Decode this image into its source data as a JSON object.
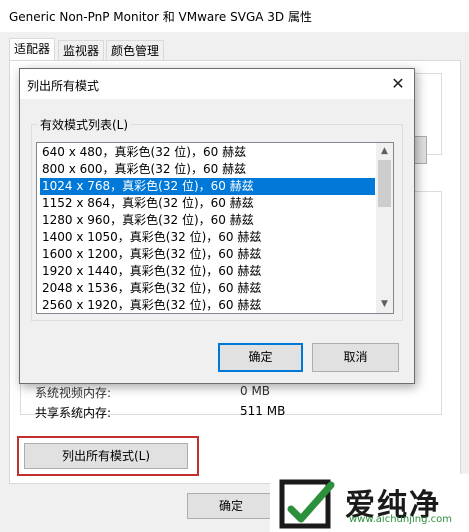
{
  "window": {
    "title": "Generic Non-PnP Monitor 和 VMware SVGA 3D 属性",
    "tabs": [
      "适配器",
      "监视器",
      "颜色管理"
    ],
    "info": [
      {
        "label": "系统视频内存:",
        "value": "0 MB"
      },
      {
        "label": "共享系统内存:",
        "value": "511 MB"
      }
    ],
    "list_all_button": "列出所有模式(L)",
    "ok_button": "确定"
  },
  "dialog": {
    "title": "列出所有模式",
    "close_glyph": "✕",
    "group_label": "有效模式列表(L)",
    "modes": [
      "640 x 480，真彩色(32 位)，60 赫兹",
      "800 x 600，真彩色(32 位)，60 赫兹",
      "1024 x 768，真彩色(32 位)，60 赫兹",
      "1152 x 864，真彩色(32 位)，60 赫兹",
      "1280 x 960，真彩色(32 位)，60 赫兹",
      "1400 x 1050，真彩色(32 位)，60 赫兹",
      "1600 x 1200，真彩色(32 位)，60 赫兹",
      "1920 x 1440，真彩色(32 位)，60 赫兹",
      "2048 x 1536，真彩色(32 位)，60 赫兹",
      "2560 x 1920，真彩色(32 位)，60 赫兹"
    ],
    "selected_mode": "1024 x 768，真彩色(32 位)，60 赫兹",
    "ok_button": "确定",
    "cancel_button": "取消"
  },
  "watermark": {
    "name": "爱纯净",
    "url": "www.aichunjing.com"
  },
  "colors": {
    "selection": "#0078d7",
    "highlight_border": "#c0302e",
    "watermark_green": "#2c8f3c"
  }
}
